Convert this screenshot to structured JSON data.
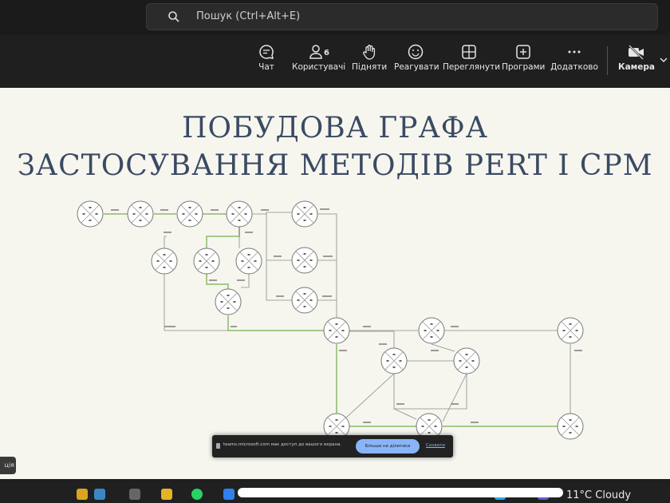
{
  "search": {
    "placeholder": "Пошук (Ctrl+Alt+E)"
  },
  "toolbar": {
    "chat": "Чат",
    "users": "Користувачі",
    "users_count": "6",
    "raise": "Підняти",
    "react": "Реагувати",
    "view": "Переглянути",
    "apps": "Програми",
    "more": "Додатково",
    "camera": "Камера"
  },
  "slide": {
    "title_line1": "ПОБУДОВА ГРАФА",
    "title_line2": "ЗАСТОСУВАННЯ МЕТОДІВ PERT І CPM"
  },
  "share_notice": {
    "message": "teams.microsoft.com має доступ до вашого екрана.",
    "stop_button": "Більше не ділитися",
    "hide_link": "Сховати"
  },
  "left_tab": {
    "label": "ція"
  },
  "taskbar": {
    "weather": "11°C  Cloudy"
  },
  "colors": {
    "graph_line": "#a7c98a",
    "node_stroke": "#777777",
    "title": "#3b4a63"
  }
}
